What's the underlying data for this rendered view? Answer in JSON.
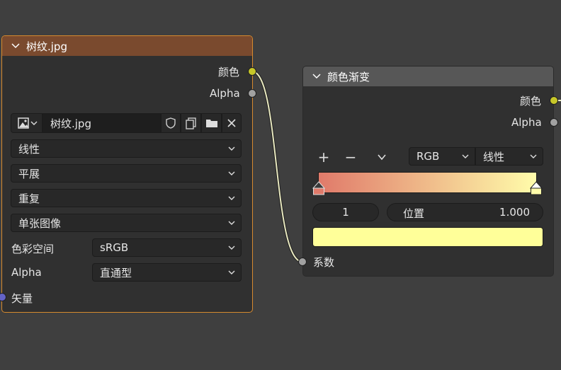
{
  "image_node": {
    "title": "树纹.jpg",
    "outputs": [
      "颜色",
      "Alpha"
    ],
    "image_name": "树纹.jpg",
    "dropdowns": [
      "线性",
      "平展",
      "重复",
      "单张图像"
    ],
    "colorspace_label": "色彩空间",
    "colorspace_value": "sRGB",
    "alpha_label": "Alpha",
    "alpha_value": "直通型",
    "vector_input": "矢量"
  },
  "ramp_node": {
    "title": "颜色渐变",
    "outputs": [
      "颜色",
      "Alpha"
    ],
    "add_label": "+",
    "remove_label": "−",
    "color_mode": "RGB",
    "interpolation": "线性",
    "active_stop_index": "1",
    "position_label": "位置",
    "position_value": "1.000",
    "input_fac": "系数",
    "gradient_start": "#e07a6a",
    "gradient_end": "#fffcaa",
    "stop_color": "#ffff99"
  },
  "colors": {
    "image_header": "#7a4a2e",
    "image_border": "#d68a2e",
    "ramp_header": "#575757",
    "socket_color": "#c7c729",
    "socket_float": "#a1a1a1",
    "socket_vector": "#6363c7"
  }
}
